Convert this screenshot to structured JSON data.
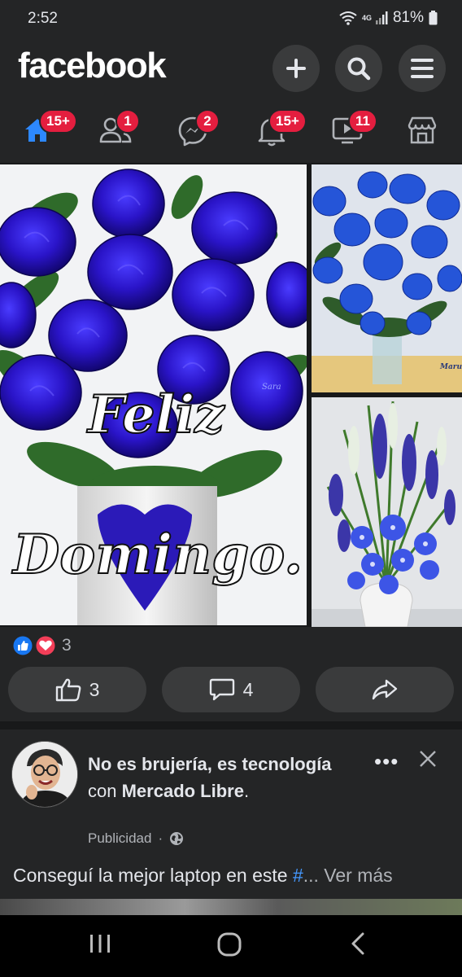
{
  "status_bar": {
    "time": "2:52",
    "network": "4G",
    "battery": "81%"
  },
  "header": {
    "logo": "facebook"
  },
  "nav": {
    "home_badge": "15+",
    "friends_badge": "1",
    "messenger_badge": "2",
    "notifications_badge": "15+",
    "video_badge": "11"
  },
  "post": {
    "image_text_line1": "Feliz",
    "image_text_line2": "Domingo.",
    "watermark_1": "Sara",
    "watermark_2": "Maru",
    "reaction_count": "3",
    "like_count": "3",
    "comment_count": "4"
  },
  "ad": {
    "title_part1": "No es brujería, es tecnología",
    "title_connector": " con ",
    "title_part2": "Mercado Libre",
    "title_end": ".",
    "meta": "Publicidad",
    "text": "Conseguí la mejor laptop en este ",
    "hashtag": "#",
    "see_more": "... Ver más"
  },
  "colors": {
    "background": "#18191a",
    "surface": "#242526",
    "button": "#3a3b3c",
    "badge": "#e41e3f",
    "accent_blue": "#1877f2"
  }
}
